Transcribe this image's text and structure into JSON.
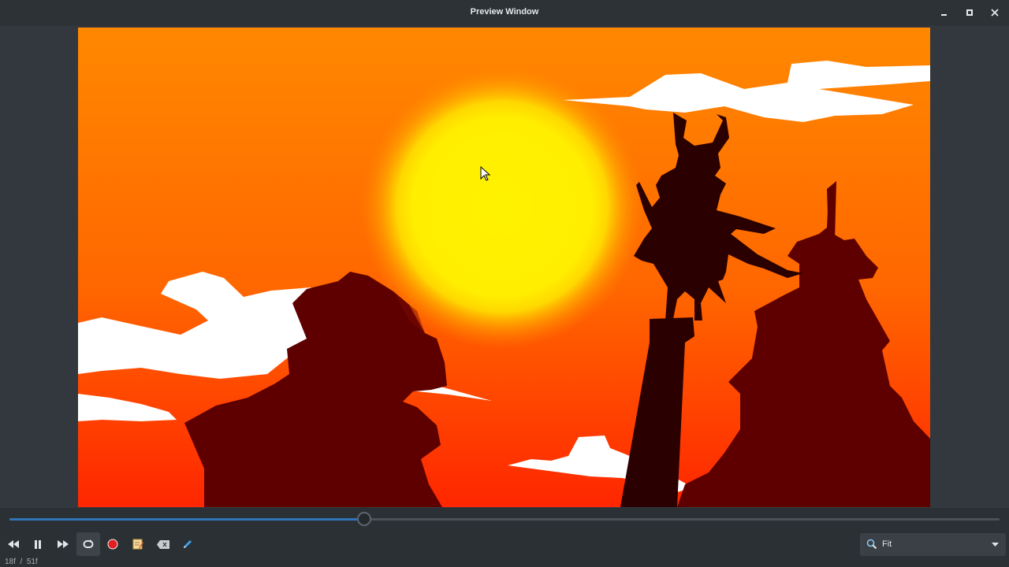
{
  "window": {
    "title": "Preview Window",
    "minimize_icon": "minimize-icon",
    "maximize_icon": "maximize-icon",
    "close_icon": "close-icon"
  },
  "playback": {
    "progress": 0.358,
    "current_frame": "18f",
    "separator": "/",
    "total_frames": "51f"
  },
  "toolbar": {
    "buttons": [
      {
        "name": "rewind-icon",
        "active": false
      },
      {
        "name": "pause-icon",
        "active": false
      },
      {
        "name": "fast-forward-icon",
        "active": false
      },
      {
        "name": "loop-icon",
        "active": true
      },
      {
        "name": "record-icon",
        "active": false,
        "color": "#e02020"
      },
      {
        "name": "notepad-icon",
        "active": false
      },
      {
        "name": "erase-icon",
        "active": false
      },
      {
        "name": "pen-icon",
        "active": false
      }
    ]
  },
  "zoom": {
    "icon": "magnifier-icon",
    "value": "Fit",
    "dropdown_icon": "chevron-down-icon"
  },
  "colors": {
    "sky_top": "#ff8a00",
    "sky_bottom": "#ff2a00",
    "sun": "#ffee00",
    "silhouette": "#5e0000",
    "accent": "#2f74b7"
  }
}
